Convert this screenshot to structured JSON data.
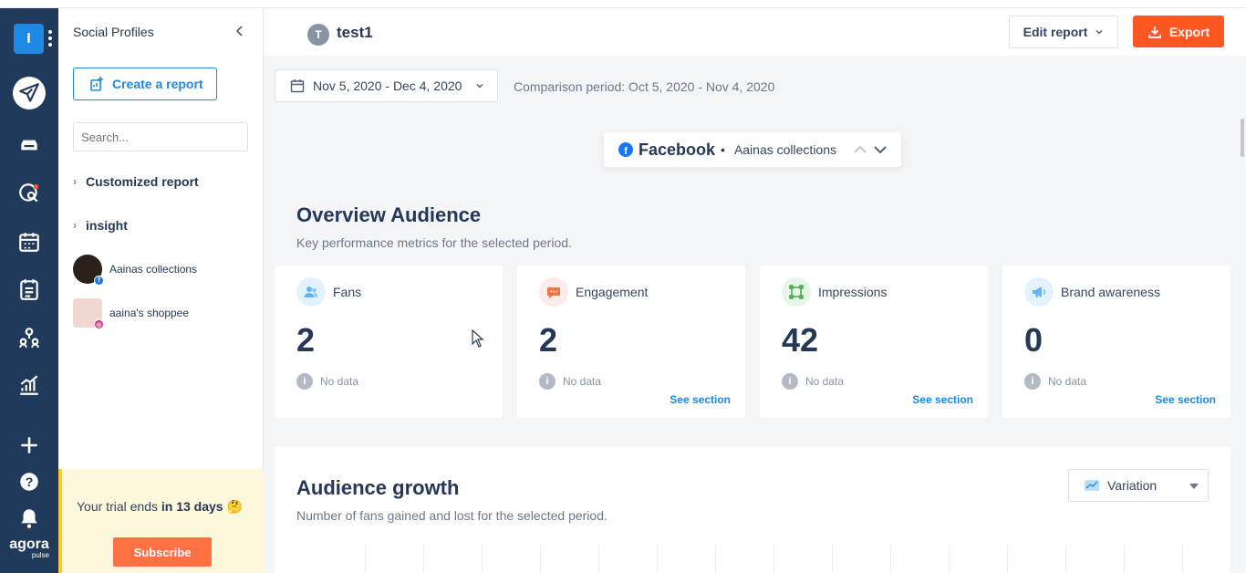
{
  "app": {
    "logo_letter": "I",
    "brand_name": "agora",
    "brand_sub": "pulse",
    "rail_icons": [
      "publish-icon",
      "inbox-icon",
      "listening-icon",
      "calendar-icon",
      "reports-icon",
      "team-icon",
      "analytics-icon",
      "plus-icon",
      "help-icon",
      "bell-icon"
    ]
  },
  "profiles": {
    "title": "Social Profiles",
    "create_label": "Create a report",
    "search_placeholder": "Search...",
    "tree": [
      {
        "label": "Customized report"
      },
      {
        "label": "insight"
      }
    ],
    "accounts": [
      {
        "name": "Aainas collections",
        "network": "facebook"
      },
      {
        "name": "aaina's shoppee",
        "network": "instagram"
      }
    ],
    "trial_prefix": "Your trial ends ",
    "trial_strong": "in 13 days",
    "trial_emoji": "🤔",
    "subscribe_label": "Subscribe"
  },
  "header": {
    "avatar_letter": "T",
    "report_title": "test1",
    "edit_label": "Edit report",
    "export_label": "Export"
  },
  "filters": {
    "date_range": "Nov 5, 2020 - Dec 4, 2020",
    "comparison": "Comparison period: Oct 5, 2020 - Nov 4, 2020"
  },
  "network": {
    "name": "Facebook",
    "separator": "•",
    "account": "Aainas collections"
  },
  "overview": {
    "title": "Overview Audience",
    "subtitle": "Key performance metrics for the selected period.",
    "cards": [
      {
        "label": "Fans",
        "value": "2",
        "note": "No data",
        "link": "",
        "icon": "fans-icon",
        "icon_bg": "#e3f2fd",
        "icon_color": "#64b5f6"
      },
      {
        "label": "Engagement",
        "value": "2",
        "note": "No data",
        "link": "See section",
        "icon": "engagement-icon",
        "icon_bg": "#fdecea",
        "icon_color": "#ff7043"
      },
      {
        "label": "Impressions",
        "value": "42",
        "note": "No data",
        "link": "See section",
        "icon": "impressions-icon",
        "icon_bg": "#e8f5e9",
        "icon_color": "#4caf50"
      },
      {
        "label": "Brand awareness",
        "value": "0",
        "note": "No data",
        "link": "See section",
        "icon": "brand-awareness-icon",
        "icon_bg": "#e3f2fd",
        "icon_color": "#64b5f6"
      }
    ]
  },
  "growth": {
    "title": "Audience growth",
    "subtitle": "Number of fans gained and lost for the selected period.",
    "variation_label": "Variation"
  },
  "colors": {
    "rail_bg": "#1f3a5a",
    "accent_blue": "#1e88e5",
    "export_orange": "#ff5722",
    "trial_bg": "#fdf7dc"
  }
}
